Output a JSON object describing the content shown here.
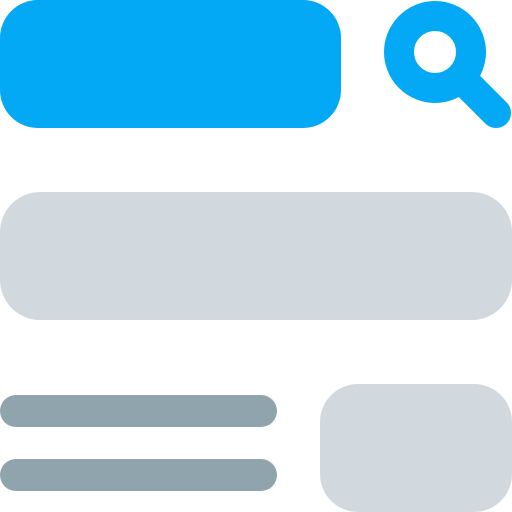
{
  "colors": {
    "accent": "#03A9F4",
    "block": "#D1D9DF",
    "line": "#90A4AE",
    "background": "#FFFFFF"
  },
  "icons": {
    "search": "search-icon"
  }
}
